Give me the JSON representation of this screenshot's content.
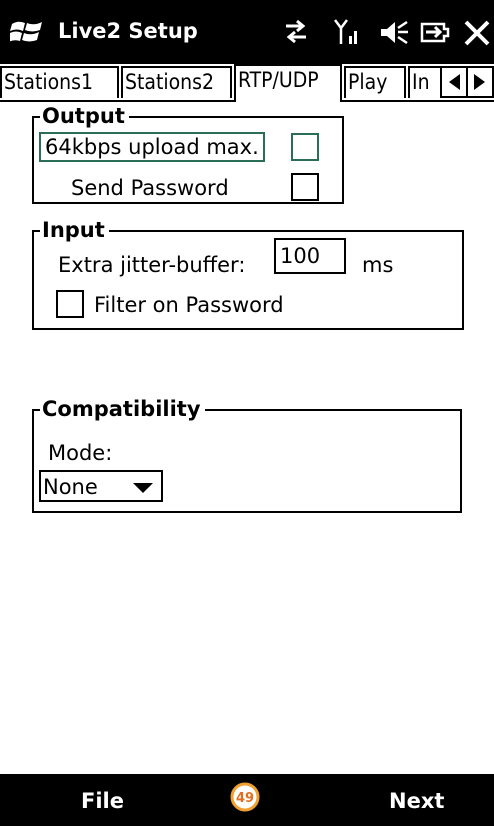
{
  "titlebar": {
    "title": "Live2 Setup",
    "icons": [
      "windows-start-icon",
      "connectivity-icon",
      "signal-icon",
      "volume-icon",
      "battery-icon",
      "close-icon"
    ]
  },
  "tabs": [
    {
      "label": "Stations1",
      "active": false
    },
    {
      "label": "Stations2",
      "active": false
    },
    {
      "label": "RTP/UDP",
      "active": true
    },
    {
      "label": "Play",
      "active": false
    },
    {
      "label": "In",
      "active": false
    }
  ],
  "output": {
    "title": "Output",
    "upload_label": "64kbps upload max.",
    "upload_checked": false,
    "password_label": "Send Password",
    "password_checked": false
  },
  "input": {
    "title": "Input",
    "jitter_label": "Extra jitter-buffer:",
    "jitter_value": "100",
    "jitter_unit": "ms",
    "filter_label": "Filter on Password",
    "filter_checked": false
  },
  "compat": {
    "title": "Compatibility",
    "mode_label": "Mode:",
    "mode_value": "None"
  },
  "menubar": {
    "left": "File",
    "right": "Next",
    "center_icon_text": "49"
  },
  "colors": {
    "bar": "#000000",
    "focus": "#2a6e5a",
    "accent": "#f0a030"
  }
}
